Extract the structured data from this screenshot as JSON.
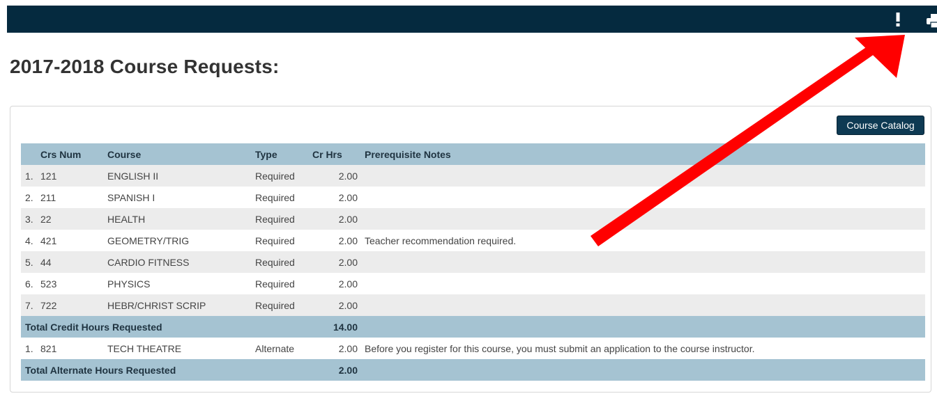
{
  "header": {
    "alert_icon": "exclamation-icon",
    "print_icon": "printer-icon"
  },
  "page": {
    "title": "2017-2018 Course Requests:"
  },
  "toolbar": {
    "course_catalog_label": "Course Catalog"
  },
  "table": {
    "columns": [
      "Crs Num",
      "Course",
      "Type",
      "Cr Hrs",
      "Prerequisite Notes"
    ],
    "requested": [
      {
        "index": "1.",
        "crs_num": "121",
        "course": "ENGLISH II",
        "type": "Required",
        "cr_hrs": "2.00",
        "notes": ""
      },
      {
        "index": "2.",
        "crs_num": "211",
        "course": "SPANISH I",
        "type": "Required",
        "cr_hrs": "2.00",
        "notes": ""
      },
      {
        "index": "3.",
        "crs_num": "22",
        "course": "HEALTH",
        "type": "Required",
        "cr_hrs": "2.00",
        "notes": ""
      },
      {
        "index": "4.",
        "crs_num": "421",
        "course": "GEOMETRY/TRIG",
        "type": "Required",
        "cr_hrs": "2.00",
        "notes": "Teacher recommendation required."
      },
      {
        "index": "5.",
        "crs_num": "44",
        "course": "CARDIO FITNESS",
        "type": "Required",
        "cr_hrs": "2.00",
        "notes": ""
      },
      {
        "index": "6.",
        "crs_num": "523",
        "course": "PHYSICS",
        "type": "Required",
        "cr_hrs": "2.00",
        "notes": ""
      },
      {
        "index": "7.",
        "crs_num": "722",
        "course": "HEBR/CHRIST SCRIP",
        "type": "Required",
        "cr_hrs": "2.00",
        "notes": ""
      }
    ],
    "total_requested": {
      "label": "Total Credit Hours Requested",
      "value": "14.00"
    },
    "alternates": [
      {
        "index": "1.",
        "crs_num": "821",
        "course": "TECH THEATRE",
        "type": "Alternate",
        "cr_hrs": "2.00",
        "notes": "Before you register for this course, you must submit an application to the course instructor."
      }
    ],
    "total_alternate": {
      "label": "Total Alternate Hours Requested",
      "value": "2.00"
    }
  },
  "colors": {
    "topbar": "#052a3f",
    "table_header": "#a5c3d2",
    "row_stripe": "#ececec",
    "button": "#0e3a53",
    "arrow": "#ff0000"
  }
}
